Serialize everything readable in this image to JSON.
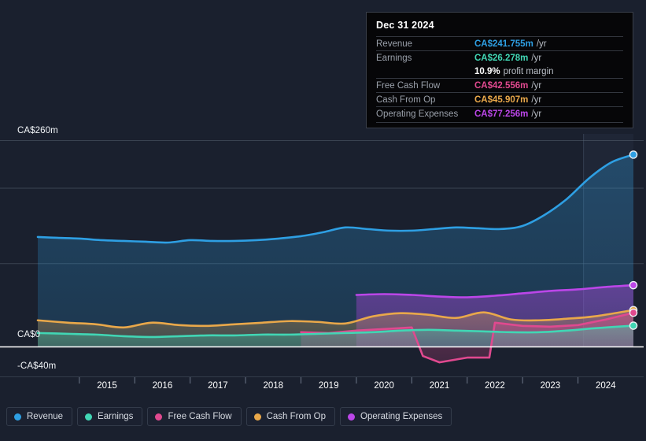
{
  "chart_data": {
    "type": "area",
    "title": "",
    "xlabel": "",
    "ylabel": "",
    "currency": "CA$",
    "units": "m",
    "ylim": [
      -40,
      260
    ],
    "y_ticks": [
      {
        "label": "CA$260m",
        "value": 260
      },
      {
        "label": "CA$0",
        "value": 0
      },
      {
        "label": "-CA$40m",
        "value": -40
      }
    ],
    "gridlines": [
      260,
      200,
      105,
      0
    ],
    "zero_line": 0,
    "x_ticks": [
      "2015",
      "2016",
      "2017",
      "2018",
      "2019",
      "2020",
      "2021",
      "2022",
      "2023",
      "2024"
    ],
    "x_range": [
      2014.25,
      2025.0
    ],
    "forecast_start": 2024.1,
    "legend_position": "bottom-left",
    "grid": true,
    "series": [
      {
        "name": "Revenue",
        "color": "#2e9fe3",
        "fill": "#1d4col",
        "x": [
          2014.25,
          2014.6,
          2015.0,
          2015.4,
          2015.8,
          2016.2,
          2016.6,
          2017.0,
          2017.4,
          2017.8,
          2018.2,
          2018.6,
          2019.0,
          2019.4,
          2019.8,
          2020.2,
          2020.6,
          2021.0,
          2021.4,
          2021.8,
          2022.2,
          2022.6,
          2023.0,
          2023.4,
          2023.8,
          2024.2,
          2024.6,
          2025.0
        ],
        "values": [
          138,
          137,
          136,
          134,
          133,
          132,
          131,
          134,
          133,
          133,
          134,
          136,
          139,
          144,
          150,
          148,
          146,
          146,
          148,
          150,
          149,
          148,
          152,
          166,
          186,
          212,
          232,
          241.755
        ]
      },
      {
        "name": "Earnings",
        "color": "#41d6b4",
        "x": [
          2014.25,
          2014.8,
          2015.3,
          2015.8,
          2016.3,
          2016.8,
          2017.3,
          2017.8,
          2018.3,
          2018.8,
          2019.3,
          2019.8,
          2020.3,
          2020.8,
          2021.3,
          2021.8,
          2022.3,
          2022.8,
          2023.3,
          2023.8,
          2024.3,
          2025.0
        ],
        "values": [
          17,
          16,
          15,
          13,
          12,
          13,
          14,
          14,
          15,
          15,
          16,
          17,
          18,
          20,
          21,
          20,
          19,
          18,
          18,
          20,
          23,
          26.278
        ]
      },
      {
        "name": "Free Cash Flow",
        "color": "#e0498f",
        "x": [
          2019.0,
          2019.5,
          2020.0,
          2020.5,
          2021.0,
          2021.2,
          2021.5,
          2022.0,
          2022.4,
          2022.5,
          2023.0,
          2023.5,
          2024.0,
          2024.5,
          2025.0
        ],
        "values": [
          18,
          17,
          20,
          22,
          24,
          -12,
          -20,
          -14,
          -14,
          30,
          26,
          25,
          27,
          34,
          42.556
        ]
      },
      {
        "name": "Cash From Op",
        "color": "#e9a84a",
        "x": [
          2014.25,
          2014.8,
          2015.3,
          2015.8,
          2016.3,
          2016.8,
          2017.3,
          2017.8,
          2018.3,
          2018.8,
          2019.3,
          2019.8,
          2020.3,
          2020.8,
          2021.3,
          2021.8,
          2022.3,
          2022.8,
          2023.3,
          2023.8,
          2024.3,
          2025.0
        ],
        "values": [
          33,
          30,
          28,
          24,
          30,
          27,
          26,
          28,
          30,
          32,
          31,
          29,
          38,
          42,
          40,
          36,
          43,
          34,
          33,
          35,
          38,
          45.907
        ]
      },
      {
        "name": "Operating Expenses",
        "color": "#bb46e8",
        "x": [
          2020.0,
          2020.5,
          2021.0,
          2021.5,
          2022.0,
          2022.5,
          2023.0,
          2023.5,
          2024.0,
          2024.5,
          2025.0
        ],
        "values": [
          65,
          66,
          65,
          63,
          62,
          64,
          67,
          70,
          72,
          75,
          77.256
        ]
      }
    ],
    "endpoints": [
      {
        "name": "Revenue",
        "value": 241.755,
        "color": "#2e9fe3"
      },
      {
        "name": "Operating Expenses",
        "value": 77.256,
        "color": "#bb46e8"
      },
      {
        "name": "Cash From Op",
        "value": 45.907,
        "color": "#e9a84a"
      },
      {
        "name": "Free Cash Flow",
        "value": 42.556,
        "color": "#e0498f"
      },
      {
        "name": "Earnings",
        "value": 26.278,
        "color": "#41d6b4"
      }
    ]
  },
  "tooltip": {
    "date": "Dec 31 2024",
    "rows": [
      {
        "label": "Revenue",
        "value": "CA$241.755m",
        "unit": "/yr",
        "color": "#2e9fe3"
      },
      {
        "label": "Earnings",
        "value": "CA$26.278m",
        "unit": "/yr",
        "color": "#41d6b4"
      },
      {
        "label": "",
        "value": "10.9%",
        "unit": "profit margin",
        "color": "#ffffff"
      },
      {
        "label": "Free Cash Flow",
        "value": "CA$42.556m",
        "unit": "/yr",
        "color": "#e0498f"
      },
      {
        "label": "Cash From Op",
        "value": "CA$45.907m",
        "unit": "/yr",
        "color": "#e9a84a"
      },
      {
        "label": "Operating Expenses",
        "value": "CA$77.256m",
        "unit": "/yr",
        "color": "#bb46e8"
      }
    ]
  },
  "legend": {
    "items": [
      {
        "label": "Revenue",
        "color": "#2e9fe3"
      },
      {
        "label": "Earnings",
        "color": "#41d6b4"
      },
      {
        "label": "Free Cash Flow",
        "color": "#e0498f"
      },
      {
        "label": "Cash From Op",
        "color": "#e9a84a"
      },
      {
        "label": "Operating Expenses",
        "color": "#bb46e8"
      }
    ]
  }
}
